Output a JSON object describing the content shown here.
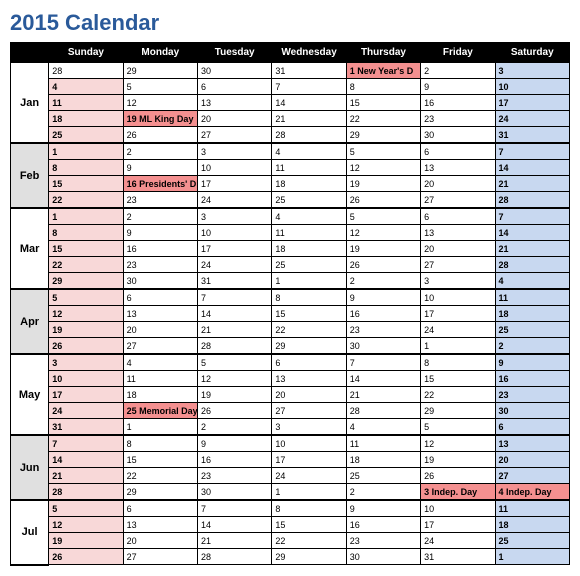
{
  "title": "2015 Calendar",
  "day_headers": [
    "Sunday",
    "Monday",
    "Tuesday",
    "Wednesday",
    "Thursday",
    "Friday",
    "Saturday"
  ],
  "months": [
    {
      "name": "Jan",
      "shade": false,
      "rows": [
        [
          {
            "t": "28",
            "c": "plain"
          },
          {
            "t": "29",
            "c": "plain"
          },
          {
            "t": "30",
            "c": "plain"
          },
          {
            "t": "31",
            "c": "plain"
          },
          {
            "t": "1  New Year's D",
            "c": "hol"
          },
          {
            "t": "2",
            "c": "plain"
          },
          {
            "t": "3",
            "c": "sat"
          }
        ],
        [
          {
            "t": "4",
            "c": "sun"
          },
          {
            "t": "5",
            "c": "plain"
          },
          {
            "t": "6",
            "c": "plain"
          },
          {
            "t": "7",
            "c": "plain"
          },
          {
            "t": "8",
            "c": "plain"
          },
          {
            "t": "9",
            "c": "plain"
          },
          {
            "t": "10",
            "c": "sat"
          }
        ],
        [
          {
            "t": "11",
            "c": "sun"
          },
          {
            "t": "12",
            "c": "plain"
          },
          {
            "t": "13",
            "c": "plain"
          },
          {
            "t": "14",
            "c": "plain"
          },
          {
            "t": "15",
            "c": "plain"
          },
          {
            "t": "16",
            "c": "plain"
          },
          {
            "t": "17",
            "c": "sat"
          }
        ],
        [
          {
            "t": "18",
            "c": "sun"
          },
          {
            "t": "19  ML King Day",
            "c": "hol"
          },
          {
            "t": "20",
            "c": "plain"
          },
          {
            "t": "21",
            "c": "plain"
          },
          {
            "t": "22",
            "c": "plain"
          },
          {
            "t": "23",
            "c": "plain"
          },
          {
            "t": "24",
            "c": "sat"
          }
        ],
        [
          {
            "t": "25",
            "c": "sun"
          },
          {
            "t": "26",
            "c": "plain"
          },
          {
            "t": "27",
            "c": "plain"
          },
          {
            "t": "28",
            "c": "plain"
          },
          {
            "t": "29",
            "c": "plain"
          },
          {
            "t": "30",
            "c": "plain"
          },
          {
            "t": "31",
            "c": "sat"
          }
        ]
      ]
    },
    {
      "name": "Feb",
      "shade": true,
      "rows": [
        [
          {
            "t": "1",
            "c": "sun"
          },
          {
            "t": "2",
            "c": "plain"
          },
          {
            "t": "3",
            "c": "plain"
          },
          {
            "t": "4",
            "c": "plain"
          },
          {
            "t": "5",
            "c": "plain"
          },
          {
            "t": "6",
            "c": "plain"
          },
          {
            "t": "7",
            "c": "sat"
          }
        ],
        [
          {
            "t": "8",
            "c": "sun"
          },
          {
            "t": "9",
            "c": "plain"
          },
          {
            "t": "10",
            "c": "plain"
          },
          {
            "t": "11",
            "c": "plain"
          },
          {
            "t": "12",
            "c": "plain"
          },
          {
            "t": "13",
            "c": "plain"
          },
          {
            "t": "14",
            "c": "sat"
          }
        ],
        [
          {
            "t": "15",
            "c": "sun"
          },
          {
            "t": "16  Presidents' D",
            "c": "hol"
          },
          {
            "t": "17",
            "c": "plain"
          },
          {
            "t": "18",
            "c": "plain"
          },
          {
            "t": "19",
            "c": "plain"
          },
          {
            "t": "20",
            "c": "plain"
          },
          {
            "t": "21",
            "c": "sat"
          }
        ],
        [
          {
            "t": "22",
            "c": "sun"
          },
          {
            "t": "23",
            "c": "plain"
          },
          {
            "t": "24",
            "c": "plain"
          },
          {
            "t": "25",
            "c": "plain"
          },
          {
            "t": "26",
            "c": "plain"
          },
          {
            "t": "27",
            "c": "plain"
          },
          {
            "t": "28",
            "c": "sat"
          }
        ]
      ]
    },
    {
      "name": "Mar",
      "shade": false,
      "rows": [
        [
          {
            "t": "1",
            "c": "sun"
          },
          {
            "t": "2",
            "c": "plain"
          },
          {
            "t": "3",
            "c": "plain"
          },
          {
            "t": "4",
            "c": "plain"
          },
          {
            "t": "5",
            "c": "plain"
          },
          {
            "t": "6",
            "c": "plain"
          },
          {
            "t": "7",
            "c": "sat"
          }
        ],
        [
          {
            "t": "8",
            "c": "sun"
          },
          {
            "t": "9",
            "c": "plain"
          },
          {
            "t": "10",
            "c": "plain"
          },
          {
            "t": "11",
            "c": "plain"
          },
          {
            "t": "12",
            "c": "plain"
          },
          {
            "t": "13",
            "c": "plain"
          },
          {
            "t": "14",
            "c": "sat"
          }
        ],
        [
          {
            "t": "15",
            "c": "sun"
          },
          {
            "t": "16",
            "c": "plain"
          },
          {
            "t": "17",
            "c": "plain"
          },
          {
            "t": "18",
            "c": "plain"
          },
          {
            "t": "19",
            "c": "plain"
          },
          {
            "t": "20",
            "c": "plain"
          },
          {
            "t": "21",
            "c": "sat"
          }
        ],
        [
          {
            "t": "22",
            "c": "sun"
          },
          {
            "t": "23",
            "c": "plain"
          },
          {
            "t": "24",
            "c": "plain"
          },
          {
            "t": "25",
            "c": "plain"
          },
          {
            "t": "26",
            "c": "plain"
          },
          {
            "t": "27",
            "c": "plain"
          },
          {
            "t": "28",
            "c": "sat"
          }
        ],
        [
          {
            "t": "29",
            "c": "sun"
          },
          {
            "t": "30",
            "c": "plain"
          },
          {
            "t": "31",
            "c": "plain"
          },
          {
            "t": "1",
            "c": "plain"
          },
          {
            "t": "2",
            "c": "plain"
          },
          {
            "t": "3",
            "c": "plain"
          },
          {
            "t": "4",
            "c": "sat"
          }
        ]
      ]
    },
    {
      "name": "Apr",
      "shade": true,
      "rows": [
        [
          {
            "t": "5",
            "c": "sun"
          },
          {
            "t": "6",
            "c": "plain"
          },
          {
            "t": "7",
            "c": "plain"
          },
          {
            "t": "8",
            "c": "plain"
          },
          {
            "t": "9",
            "c": "plain"
          },
          {
            "t": "10",
            "c": "plain"
          },
          {
            "t": "11",
            "c": "sat"
          }
        ],
        [
          {
            "t": "12",
            "c": "sun"
          },
          {
            "t": "13",
            "c": "plain"
          },
          {
            "t": "14",
            "c": "plain"
          },
          {
            "t": "15",
            "c": "plain"
          },
          {
            "t": "16",
            "c": "plain"
          },
          {
            "t": "17",
            "c": "plain"
          },
          {
            "t": "18",
            "c": "sat"
          }
        ],
        [
          {
            "t": "19",
            "c": "sun"
          },
          {
            "t": "20",
            "c": "plain"
          },
          {
            "t": "21",
            "c": "plain"
          },
          {
            "t": "22",
            "c": "plain"
          },
          {
            "t": "23",
            "c": "plain"
          },
          {
            "t": "24",
            "c": "plain"
          },
          {
            "t": "25",
            "c": "sat"
          }
        ],
        [
          {
            "t": "26",
            "c": "sun"
          },
          {
            "t": "27",
            "c": "plain"
          },
          {
            "t": "28",
            "c": "plain"
          },
          {
            "t": "29",
            "c": "plain"
          },
          {
            "t": "30",
            "c": "plain"
          },
          {
            "t": "1",
            "c": "plain"
          },
          {
            "t": "2",
            "c": "sat"
          }
        ]
      ]
    },
    {
      "name": "May",
      "shade": false,
      "rows": [
        [
          {
            "t": "3",
            "c": "sun"
          },
          {
            "t": "4",
            "c": "plain"
          },
          {
            "t": "5",
            "c": "plain"
          },
          {
            "t": "6",
            "c": "plain"
          },
          {
            "t": "7",
            "c": "plain"
          },
          {
            "t": "8",
            "c": "plain"
          },
          {
            "t": "9",
            "c": "sat"
          }
        ],
        [
          {
            "t": "10",
            "c": "sun"
          },
          {
            "t": "11",
            "c": "plain"
          },
          {
            "t": "12",
            "c": "plain"
          },
          {
            "t": "13",
            "c": "plain"
          },
          {
            "t": "14",
            "c": "plain"
          },
          {
            "t": "15",
            "c": "plain"
          },
          {
            "t": "16",
            "c": "sat"
          }
        ],
        [
          {
            "t": "17",
            "c": "sun"
          },
          {
            "t": "18",
            "c": "plain"
          },
          {
            "t": "19",
            "c": "plain"
          },
          {
            "t": "20",
            "c": "plain"
          },
          {
            "t": "21",
            "c": "plain"
          },
          {
            "t": "22",
            "c": "plain"
          },
          {
            "t": "23",
            "c": "sat"
          }
        ],
        [
          {
            "t": "24",
            "c": "sun"
          },
          {
            "t": "25  Memorial Day",
            "c": "hol"
          },
          {
            "t": "26",
            "c": "plain"
          },
          {
            "t": "27",
            "c": "plain"
          },
          {
            "t": "28",
            "c": "plain"
          },
          {
            "t": "29",
            "c": "plain"
          },
          {
            "t": "30",
            "c": "sat"
          }
        ],
        [
          {
            "t": "31",
            "c": "sun"
          },
          {
            "t": "1",
            "c": "plain"
          },
          {
            "t": "2",
            "c": "plain"
          },
          {
            "t": "3",
            "c": "plain"
          },
          {
            "t": "4",
            "c": "plain"
          },
          {
            "t": "5",
            "c": "plain"
          },
          {
            "t": "6",
            "c": "sat"
          }
        ]
      ]
    },
    {
      "name": "Jun",
      "shade": true,
      "rows": [
        [
          {
            "t": "7",
            "c": "sun"
          },
          {
            "t": "8",
            "c": "plain"
          },
          {
            "t": "9",
            "c": "plain"
          },
          {
            "t": "10",
            "c": "plain"
          },
          {
            "t": "11",
            "c": "plain"
          },
          {
            "t": "12",
            "c": "plain"
          },
          {
            "t": "13",
            "c": "sat"
          }
        ],
        [
          {
            "t": "14",
            "c": "sun"
          },
          {
            "t": "15",
            "c": "plain"
          },
          {
            "t": "16",
            "c": "plain"
          },
          {
            "t": "17",
            "c": "plain"
          },
          {
            "t": "18",
            "c": "plain"
          },
          {
            "t": "19",
            "c": "plain"
          },
          {
            "t": "20",
            "c": "sat"
          }
        ],
        [
          {
            "t": "21",
            "c": "sun"
          },
          {
            "t": "22",
            "c": "plain"
          },
          {
            "t": "23",
            "c": "plain"
          },
          {
            "t": "24",
            "c": "plain"
          },
          {
            "t": "25",
            "c": "plain"
          },
          {
            "t": "26",
            "c": "plain"
          },
          {
            "t": "27",
            "c": "sat"
          }
        ],
        [
          {
            "t": "28",
            "c": "sun"
          },
          {
            "t": "29",
            "c": "plain"
          },
          {
            "t": "30",
            "c": "plain"
          },
          {
            "t": "1",
            "c": "plain"
          },
          {
            "t": "2",
            "c": "plain"
          },
          {
            "t": "3  Indep. Day",
            "c": "hol"
          },
          {
            "t": "4  Indep. Day",
            "c": "hol"
          }
        ]
      ]
    },
    {
      "name": "Jul",
      "shade": false,
      "rows": [
        [
          {
            "t": "5",
            "c": "sun"
          },
          {
            "t": "6",
            "c": "plain"
          },
          {
            "t": "7",
            "c": "plain"
          },
          {
            "t": "8",
            "c": "plain"
          },
          {
            "t": "9",
            "c": "plain"
          },
          {
            "t": "10",
            "c": "plain"
          },
          {
            "t": "11",
            "c": "sat"
          }
        ],
        [
          {
            "t": "12",
            "c": "sun"
          },
          {
            "t": "13",
            "c": "plain"
          },
          {
            "t": "14",
            "c": "plain"
          },
          {
            "t": "15",
            "c": "plain"
          },
          {
            "t": "16",
            "c": "plain"
          },
          {
            "t": "17",
            "c": "plain"
          },
          {
            "t": "18",
            "c": "sat"
          }
        ],
        [
          {
            "t": "19",
            "c": "sun"
          },
          {
            "t": "20",
            "c": "plain"
          },
          {
            "t": "21",
            "c": "plain"
          },
          {
            "t": "22",
            "c": "plain"
          },
          {
            "t": "23",
            "c": "plain"
          },
          {
            "t": "24",
            "c": "plain"
          },
          {
            "t": "25",
            "c": "sat"
          }
        ],
        [
          {
            "t": "26",
            "c": "sun"
          },
          {
            "t": "27",
            "c": "plain"
          },
          {
            "t": "28",
            "c": "plain"
          },
          {
            "t": "29",
            "c": "plain"
          },
          {
            "t": "30",
            "c": "plain"
          },
          {
            "t": "31",
            "c": "plain"
          },
          {
            "t": "1",
            "c": "sat"
          }
        ]
      ]
    }
  ]
}
